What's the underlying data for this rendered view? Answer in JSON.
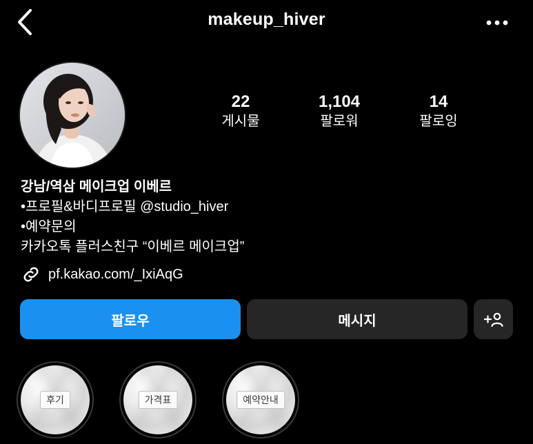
{
  "header": {
    "back_icon": "chevron-left-icon",
    "username": "makeup_hiver",
    "more_icon": "more-horizontal-icon"
  },
  "profile": {
    "avatar": "profile-photo",
    "stats": [
      {
        "value": "22",
        "label": "게시물"
      },
      {
        "value": "1,104",
        "label": "팔로워"
      },
      {
        "value": "14",
        "label": "팔로잉"
      }
    ]
  },
  "bio": {
    "name": "강남/역삼 메이크업 이베르",
    "lines": [
      "•프로필&바디프로필 @studio_hiver",
      "•예약문의",
      "카카오톡 플러스친구 “이베르 메이크업”"
    ],
    "link_icon": "link-icon",
    "link": "pf.kakao.com/_IxiAqG"
  },
  "actions": {
    "follow": "팔로우",
    "message": "메시지",
    "add_user_icon": "add-user-icon"
  },
  "highlights": [
    {
      "label": "후기"
    },
    {
      "label": "가격표"
    },
    {
      "label": "예약안내"
    }
  ],
  "colors": {
    "background": "#000000",
    "follow_button": "#1a91f1",
    "secondary_button": "#262626"
  }
}
